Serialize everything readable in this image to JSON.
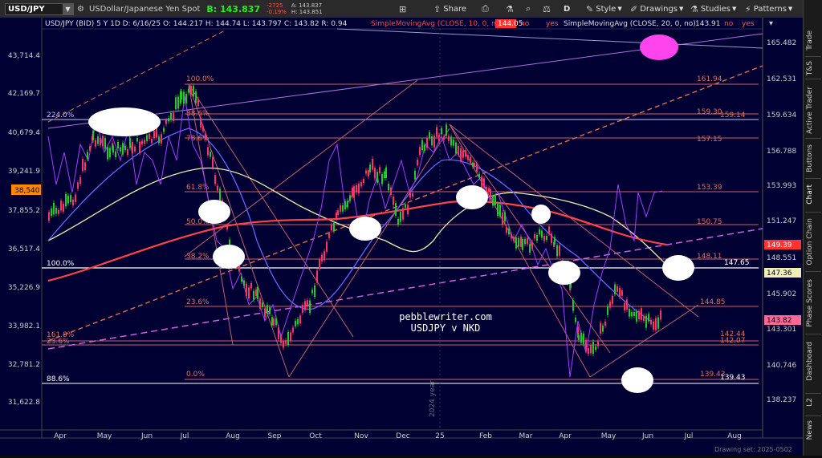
{
  "toolbar": {
    "symbol": "USD/JPY",
    "description": "USDollar/Japanese Yen Spot",
    "bid": "B: 143.837",
    "change": "-2725",
    "change_pct": "-0.19%",
    "ask_top": "A: 143.837",
    "ask_bottom": "H: 143.851",
    "share_label": "Share",
    "period_label": "D",
    "style_label": "Style",
    "drawings_label": "Drawings",
    "studies_label": "Studies",
    "patterns_label": "Patterns"
  },
  "right_panel": [
    "Trade",
    "T&S",
    "Active Trader",
    "Buttons",
    "Chart",
    "Option Chain",
    "Phase Scores",
    "Dashboard",
    "L2",
    "News"
  ],
  "header": {
    "ohlc": "USD/JPY (BID) 5 Y 1D   D: 6/16/25   O: 144.217   H: 144.74   L: 143.797   C: 143.82   R: 0.94",
    "sma10": "SimpleMovingAvg (CLOSE, 10, 0, no)",
    "sma10_val": "144.05",
    "sma10_flag": "no",
    "sma10_yes": "yes",
    "sma20": "SimpleMovingAvg (CLOSE, 20, 0, no)",
    "sma20_val": "143.91",
    "sma20_flag": "no",
    "sma20_yes": "yes"
  },
  "left_axis": [
    "43,714.4",
    "42,169.7",
    "40,679.4",
    "39,241.9",
    "37,855.2",
    "36,517.4",
    "35,226.9",
    "33,982.1",
    "32,781.2",
    "31,622.8"
  ],
  "left_badge": "38,540",
  "right_axis": [
    "165.482",
    "162.531",
    "159.634",
    "156.788",
    "153.993",
    "151.247",
    "148.551",
    "145.902",
    "143.301",
    "140.746",
    "138.237"
  ],
  "right_badges": {
    "sma_a": "149.39",
    "level": "147.36",
    "price": "143.82"
  },
  "x_axis": [
    "Apr",
    "May",
    "Jun",
    "Jul",
    "Aug",
    "Sep",
    "Oct",
    "Nov",
    "Dec",
    "25",
    "Feb",
    "Mar",
    "Apr",
    "May",
    "Jun",
    "Jul",
    "Aug"
  ],
  "fib_left": [
    "100.0%",
    "88.6%",
    "78.6%",
    "61.8%",
    "50.0%",
    "38.2%",
    "23.6%",
    "0.0%"
  ],
  "fib_far_left": [
    "224.0%",
    "100.0%",
    "161.8%",
    "23.6%",
    "88.6%"
  ],
  "fib_right": [
    "161.94",
    "159.30",
    "159.14",
    "157.15",
    "153.39",
    "150.75",
    "148.11",
    "147.65",
    "144.85",
    "142.44",
    "142.07",
    "139.43",
    "139.43"
  ],
  "watermark": {
    "line1": "pebblewriter.com",
    "line2": "USDJPY v NKD"
  },
  "year_label": "2024 year",
  "footer": "Drawing set: 2025-0502",
  "colors": {
    "bg": "#000033",
    "bullish": "#22cc22",
    "bearish": "#ff3366",
    "fib": "#e07060",
    "sma_red": "#ff4444",
    "sma_blue": "#6666ff",
    "sma_yellow": "#eeeeaa",
    "nkd": "#a040ff"
  }
}
